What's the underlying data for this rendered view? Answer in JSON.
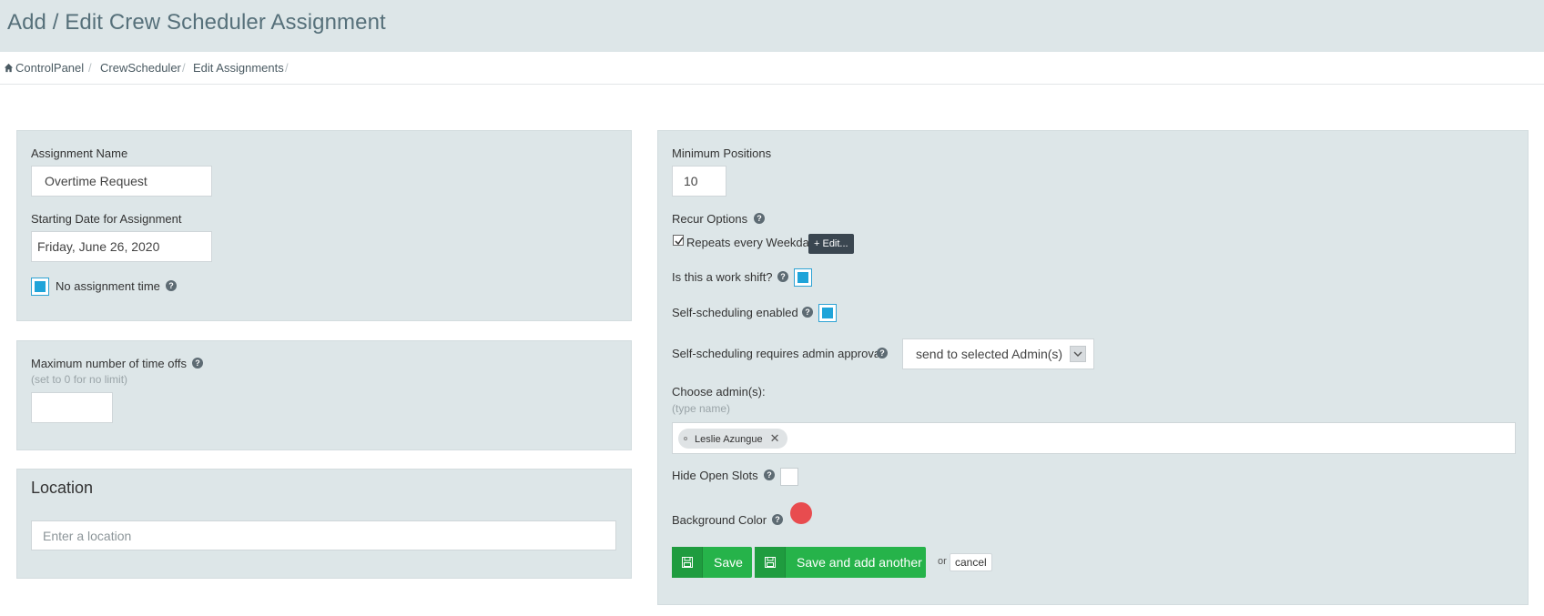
{
  "page": {
    "title": "Add / Edit Crew Scheduler Assignment"
  },
  "breadcrumb": {
    "items": [
      "ControlPanel",
      "CrewScheduler",
      "Edit Assignments"
    ],
    "separator": "/"
  },
  "left_panel": {
    "assignment_name_label": "Assignment Name",
    "assignment_name_value": "Overtime Request",
    "start_date_label": "Starting Date for Assignment",
    "start_date_value": "Friday, June 26, 2020",
    "no_assignment_time_label": "No assignment time",
    "no_assignment_time_checked": true
  },
  "timeoffs_panel": {
    "label": "Maximum number of time offs",
    "hint": "(set to 0 for no limit)",
    "value": ""
  },
  "location_panel": {
    "title": "Location",
    "placeholder": "Enter a location"
  },
  "right_panel": {
    "min_positions_label": "Minimum Positions",
    "min_positions_value": "10",
    "recur_options_label": "Recur Options",
    "recur_text": "Repeats every Weekday",
    "recur_checked": true,
    "edit_button_label": "+ Edit...",
    "work_shift_label": "Is this a work shift?",
    "work_shift_checked": true,
    "self_scheduling_label": "Self-scheduling enabled",
    "self_scheduling_checked": true,
    "admin_approval_label": "Self-scheduling requires admin approval",
    "admin_approval_selected": "send to selected Admin(s)",
    "choose_admins_label": "Choose admin(s):",
    "choose_admins_hint": "(type name)",
    "selected_admins": [
      "Leslie Azungue"
    ],
    "hide_open_slots_label": "Hide Open Slots",
    "hide_open_slots_checked": false,
    "background_color_label": "Background Color",
    "background_color": "#e84c4f"
  },
  "actions": {
    "save_label": "Save",
    "save_add_label": "Save and add another",
    "or_text": "or",
    "cancel_label": "cancel"
  },
  "colors": {
    "accent_green": "#26b34a",
    "checkbox_blue": "#1fa4d9",
    "panel_bg": "#dde6e8"
  },
  "help_icon_glyph": "?"
}
